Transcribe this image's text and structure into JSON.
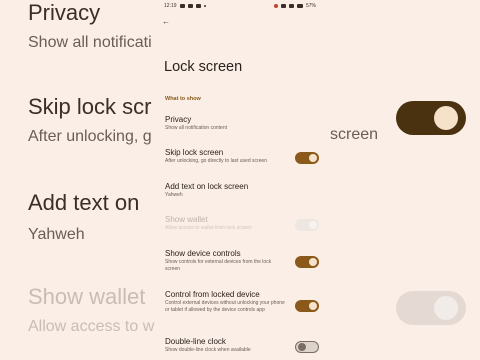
{
  "status_bar": {
    "time": "12:19",
    "battery": "57%"
  },
  "page": {
    "title": "Lock screen",
    "section": "What to show"
  },
  "rows": [
    {
      "title": "Privacy",
      "subtitle": "Show all notification content",
      "toggle": "none"
    },
    {
      "title": "Skip lock screen",
      "subtitle": "After unlocking, go directly to last used screen",
      "toggle": "on"
    },
    {
      "title": "Add text on lock screen",
      "subtitle": "Yahweh",
      "toggle": "none"
    },
    {
      "title": "Show wallet",
      "subtitle": "Allow access to wallet from lock screen",
      "toggle": "disabled"
    },
    {
      "title": "Show device controls",
      "subtitle": "Show controls for external devices from the lock screen",
      "toggle": "on"
    },
    {
      "title": "Control from locked device",
      "subtitle": "Control external devices without unlocking your phone or tablet if allowed by the device controls app",
      "toggle": "on"
    },
    {
      "title": "Double-line clock",
      "subtitle": "Show double-line clock when available",
      "toggle": "off"
    }
  ],
  "background": {
    "privacy_title": "Privacy",
    "privacy_sub": "Show all notificati",
    "skip_title": "Skip lock scr",
    "skip_sub_left": "After unlocking, g",
    "skip_sub_right": "screen",
    "addtext_title": "Add text on",
    "addtext_sub": "Yahweh",
    "wallet_title": "Show wallet",
    "wallet_sub": "Allow access to w"
  },
  "colors": {
    "accent": "#8b5a1a",
    "background": "#fbeee6"
  }
}
